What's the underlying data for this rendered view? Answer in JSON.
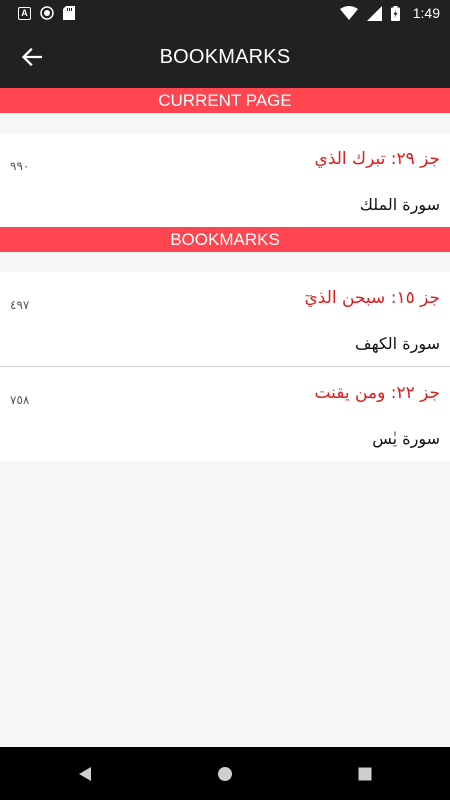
{
  "status_bar": {
    "time": "1:49",
    "icons": [
      "a-notification-icon",
      "circle-notification-icon",
      "sd-card-icon",
      "wifi-icon",
      "signal-icon",
      "battery-icon"
    ]
  },
  "app_bar": {
    "title": "BOOKMARKS",
    "back_icon": "arrow-back-icon"
  },
  "current_page": {
    "header": "CURRENT PAGE",
    "item": {
      "juz": "جز ٢٩: تبرك الذي",
      "page": "٩٩٠",
      "surah": "سورة الملك"
    }
  },
  "bookmarks": {
    "header": "BOOKMARKS",
    "items": [
      {
        "juz": "جز ١٥: سبحن الذيٓ",
        "page": "٤٩٧",
        "surah": "سورة الكهف"
      },
      {
        "juz": "جز ٢٢: ومن يقنت",
        "page": "٧٥٨",
        "surah": "سورة يٰس"
      }
    ]
  },
  "nav_bar": {
    "icons": [
      "back-triangle-icon",
      "home-circle-icon",
      "recents-square-icon"
    ]
  },
  "colors": {
    "bar_bg": "#212121",
    "section_header": "#ff4650",
    "juz_text": "#e01b1b",
    "background": "#f7f7f7"
  }
}
